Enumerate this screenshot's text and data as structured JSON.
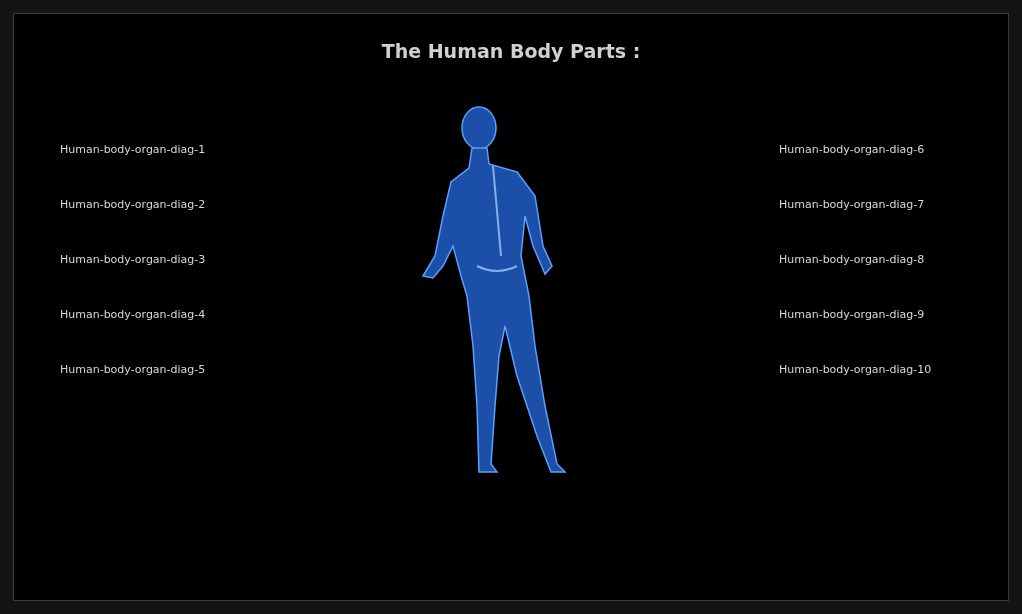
{
  "title": "The Human Body Parts :",
  "left_labels": [
    "Human-body-organ-diag-1",
    "Human-body-organ-diag-2",
    "Human-body-organ-diag-3",
    "Human-body-organ-diag-4",
    "Human-body-organ-diag-5"
  ],
  "right_labels": [
    "Human-body-organ-diag-6",
    "Human-body-organ-diag-7",
    "Human-body-organ-diag-8",
    "Human-body-organ-diag-9",
    "Human-body-organ-diag-10"
  ]
}
